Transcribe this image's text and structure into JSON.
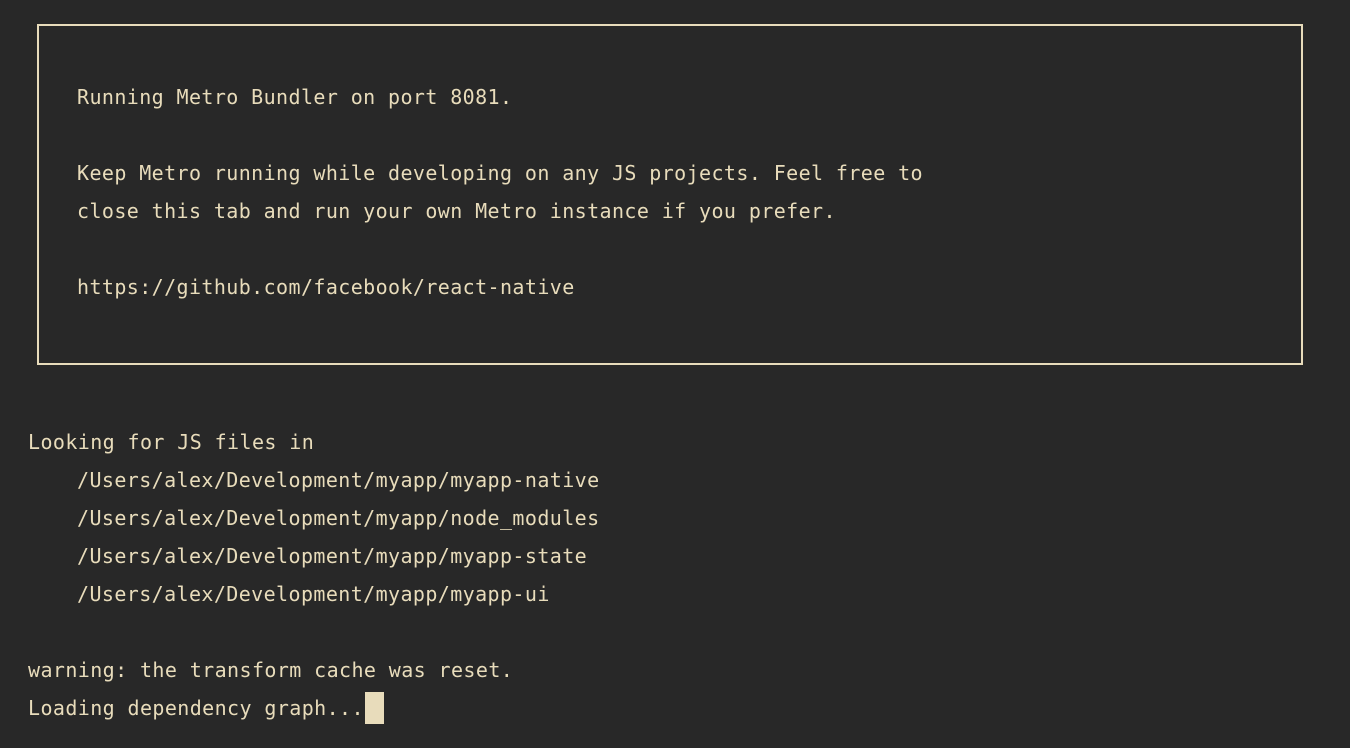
{
  "terminal": {
    "background_color": "#282828",
    "text_color": "#e8dcbb",
    "border_color": "#e8dcbb",
    "cursor_color": "#e8dcbb"
  },
  "banner": {
    "line1": "Running Metro Bundler on port 8081.",
    "line2": "Keep Metro running while developing on any JS projects. Feel free to",
    "line3": "close this tab and run your own Metro instance if you prefer.",
    "line4": "https://github.com/facebook/react-native"
  },
  "output": {
    "looking_header": "Looking for JS files in",
    "paths": [
      "/Users/alex/Development/myapp/myapp-native",
      "/Users/alex/Development/myapp/node_modules",
      "/Users/alex/Development/myapp/myapp-state",
      "/Users/alex/Development/myapp/myapp-ui"
    ],
    "warning": "warning: the transform cache was reset.",
    "loading": "Loading dependency graph..."
  }
}
